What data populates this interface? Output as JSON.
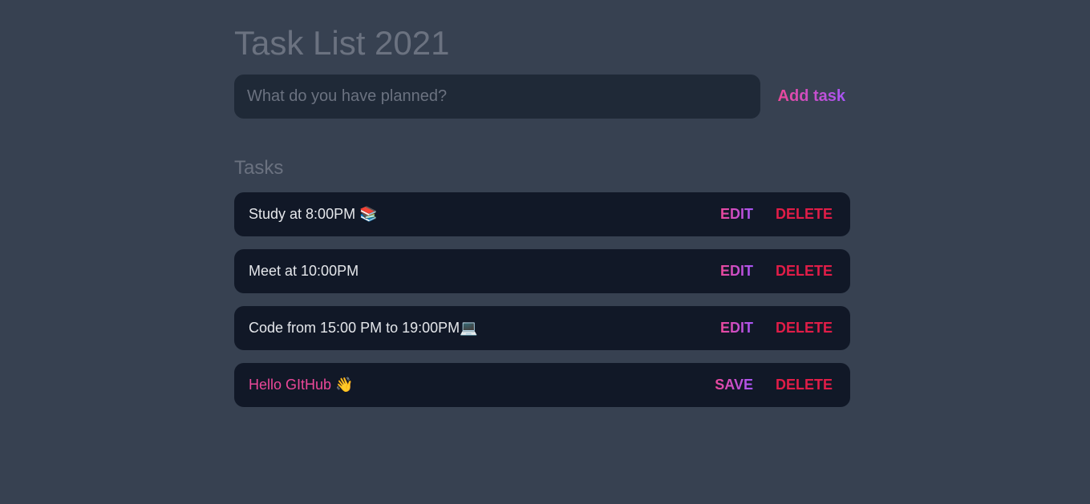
{
  "page": {
    "title": "Task List 2021",
    "section_title": "Tasks"
  },
  "form": {
    "placeholder": "What do you have planned?",
    "value": "",
    "add_label": "Add task"
  },
  "tasks": [
    {
      "text": "Study at 8:00PM 📚",
      "edit_label": "EDIT",
      "delete_label": "DELETE",
      "editing": false
    },
    {
      "text": "Meet at 10:00PM",
      "edit_label": "EDIT",
      "delete_label": "DELETE",
      "editing": false
    },
    {
      "text": "Code from 15:00 PM to 19:00PM💻",
      "edit_label": "EDIT",
      "delete_label": "DELETE",
      "editing": false
    },
    {
      "text": "Hello GItHub 👋",
      "edit_label": "SAVE",
      "delete_label": "DELETE",
      "editing": true
    }
  ],
  "colors": {
    "background": "#374151",
    "input_bg": "#1f2937",
    "task_bg": "#111827",
    "accent_pink": "#ec4899",
    "accent_purple": "#a855f7",
    "delete_red": "#e11d48"
  }
}
